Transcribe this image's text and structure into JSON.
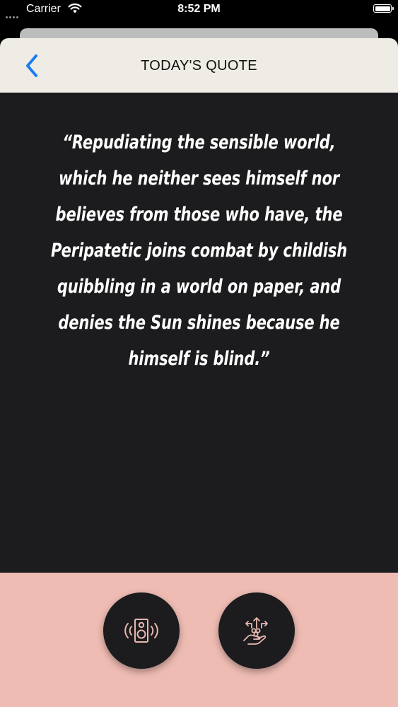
{
  "status_bar": {
    "carrier": "Carrier",
    "time": "8:52 PM"
  },
  "nav": {
    "title": "TODAY'S QUOTE",
    "back_icon": "chevron-left-icon"
  },
  "quote": {
    "text": "“Repudiating the sensible world, which he neither sees himself nor believes from those who have, the Peripatetic joins combat by childish quibbling in a world on paper, and denies the Sun shines because he himself is blind.”"
  },
  "actions": {
    "speak_icon": "speaker-icon",
    "share_icon": "hand-share-icon"
  },
  "colors": {
    "nav_bg": "#efece5",
    "quote_bg": "#1c1c1e",
    "footer_bg": "#efbcb3",
    "accent": "#1a7cf5",
    "icon_tint": "#e9b7ae"
  }
}
